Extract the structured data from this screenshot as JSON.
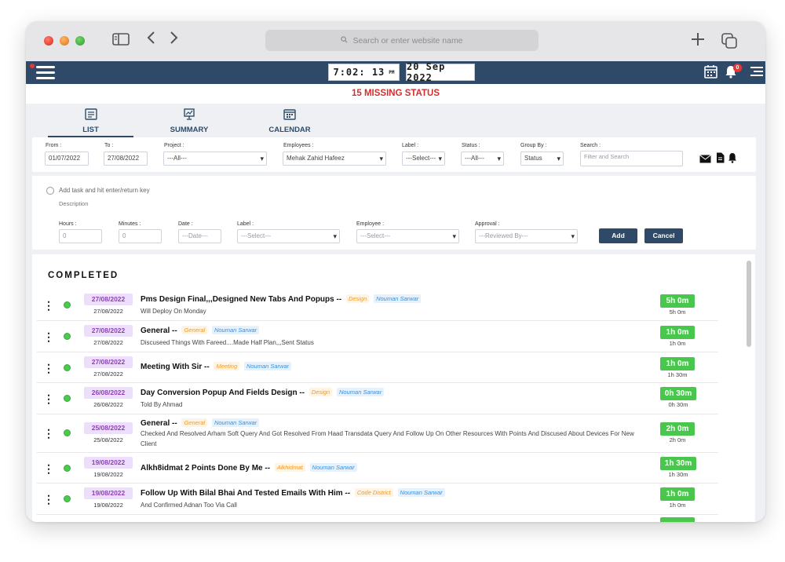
{
  "browser": {
    "url_placeholder": "Search or enter website name"
  },
  "header": {
    "time": "7:02: 13",
    "time_suffix": "PM",
    "date": "20 Sep 2022",
    "notification_count": "0"
  },
  "missing_status": "15 MISSING STATUS",
  "tabs": [
    {
      "label": "LIST",
      "icon": "list-icon",
      "active": true
    },
    {
      "label": "SUMMARY",
      "icon": "presentation-icon",
      "active": false
    },
    {
      "label": "CALENDAR",
      "icon": "calendar-icon",
      "active": false
    }
  ],
  "filters": {
    "from": {
      "label": "From :",
      "value": "01/07/2022"
    },
    "to": {
      "label": "To :",
      "value": "27/08/2022"
    },
    "project": {
      "label": "Project :",
      "value": "---All---"
    },
    "employees": {
      "label": "Employees :",
      "value": "Mehak Zahid Hafeez"
    },
    "label": {
      "label": "Label :",
      "value": "---Select---"
    },
    "status": {
      "label": "Status :",
      "value": "---All---"
    },
    "group_by": {
      "label": "Group By :",
      "value": "Status"
    },
    "search": {
      "label": "Search :",
      "placeholder": "Filter and Search"
    }
  },
  "add_task": {
    "task_placeholder": "Add task and hit enter/return key",
    "description_placeholder": "Description",
    "hours": {
      "label": "Hours :",
      "placeholder": "0"
    },
    "minutes": {
      "label": "Minutes :",
      "placeholder": "0"
    },
    "date": {
      "label": "Date :",
      "placeholder": "---Date---"
    },
    "label": {
      "label": "Label :",
      "value": "---Select---"
    },
    "employee": {
      "label": "Employee :",
      "value": "---Select---"
    },
    "approval": {
      "label": "Approval :",
      "value": "---Reviewed By---"
    },
    "add_label": "Add",
    "cancel_label": "Cancel"
  },
  "list": {
    "section_title": "COMPLETED",
    "tasks": [
      {
        "date": "27/08/2022",
        "sub_date": "27/08/2022",
        "title": "Pms Design Final,,,Designed New Tabs And Popups --",
        "label": "Design",
        "employee": "Nouman Sarwar",
        "description": "Will Deploy On Monday",
        "duration": "5h 0m",
        "duration_sub": "5h 0m"
      },
      {
        "date": "27/08/2022",
        "sub_date": "27/08/2022",
        "title": "General --",
        "label": "General",
        "employee": "Nouman Sarwar",
        "description": "Discuseed Things With Fareed....Made Half Plan,,,Sent Status",
        "duration": "1h 0m",
        "duration_sub": "1h 0m"
      },
      {
        "date": "27/08/2022",
        "sub_date": "27/08/2022",
        "title": "Meeting With Sir --",
        "label": "Meeting",
        "employee": "Nouman Sarwar",
        "description": "",
        "duration": "1h 0m",
        "duration_sub": "1h 30m"
      },
      {
        "date": "26/08/2022",
        "sub_date": "26/08/2022",
        "title": "Day Conversion Popup And Fields Design --",
        "label": "Design",
        "employee": "Nouman Sarwar",
        "description": "Told By Ahmad",
        "duration": "0h 30m",
        "duration_sub": "0h 30m"
      },
      {
        "date": "25/08/2022",
        "sub_date": "25/08/2022",
        "title": "General --",
        "label": "General",
        "employee": "Nouman Sarwar",
        "description": "Checked And Resolved Arham Soft Query And Got Resolved From Haad Transdata Query And Follow Up On Other Resources With Points And Discused About Devices For New Client",
        "duration": "2h 0m",
        "duration_sub": "2h 0m"
      },
      {
        "date": "19/08/2022",
        "sub_date": "19/08/2022",
        "title": "Alkh8idmat 2 Points Done By Me --",
        "label": "Alkhidmat",
        "employee": "Nouman Sarwar",
        "description": "",
        "duration": "1h 30m",
        "duration_sub": "1h 30m"
      },
      {
        "date": "19/08/2022",
        "sub_date": "19/08/2022",
        "title": "Follow Up With Bilal Bhai And Tested Emails With Him  --",
        "label": "Code District",
        "employee": "Nouman Sarwar",
        "description": "And Confirmed Adnan Too Via Call",
        "duration": "1h 0m",
        "duration_sub": "1h 0m"
      }
    ]
  }
}
